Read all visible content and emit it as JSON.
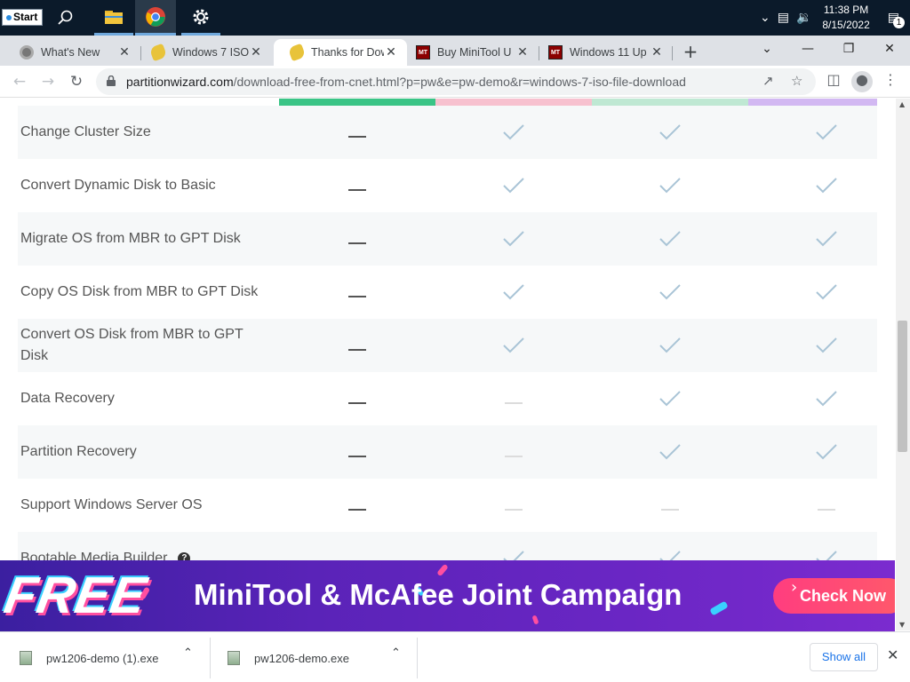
{
  "taskbar": {
    "start_label": "Start",
    "time": "11:38 PM",
    "date": "8/15/2022",
    "notification_count": "1"
  },
  "tabs": [
    {
      "title": "What's New",
      "favicon": "gear-favicon"
    },
    {
      "title": "Windows 7 ISO",
      "favicon": "windows-favicon"
    },
    {
      "title": "Thanks for Dow",
      "favicon": "windows-favicon",
      "active": true
    },
    {
      "title": "Buy MiniTool U",
      "favicon": "minitool-favicon"
    },
    {
      "title": "Windows 11 Up",
      "favicon": "minitool-favicon"
    }
  ],
  "favicon_text": "MT",
  "address": {
    "host": "partitionwizard.com",
    "path": "/download-free-from-cnet.html?p=pw&e=pw-demo&r=windows-7-iso-file-download"
  },
  "plan_colors": [
    "#3ac486",
    "#f7c1cf",
    "#bfe8d3",
    "#d2b8f2"
  ],
  "features": [
    {
      "name": "Change Cluster Size",
      "cells": [
        "dash",
        "check",
        "check",
        "check"
      ]
    },
    {
      "name": "Convert Dynamic Disk to Basic",
      "cells": [
        "dash",
        "check",
        "check",
        "check"
      ]
    },
    {
      "name": "Migrate OS from MBR to GPT Disk",
      "cells": [
        "dash",
        "check",
        "check",
        "check"
      ]
    },
    {
      "name": "Copy OS Disk from MBR to GPT Disk",
      "cells": [
        "dash",
        "check",
        "check",
        "check"
      ]
    },
    {
      "name": "Convert OS Disk from MBR to GPT Disk",
      "cells": [
        "dash",
        "check",
        "check",
        "check"
      ]
    },
    {
      "name": "Data Recovery",
      "cells": [
        "dash",
        "light-dash",
        "check",
        "check"
      ]
    },
    {
      "name": "Partition Recovery",
      "cells": [
        "dash",
        "light-dash",
        "check",
        "check"
      ]
    },
    {
      "name": "Support Windows Server OS",
      "cells": [
        "dash",
        "light-dash",
        "light-dash",
        "light-dash"
      ]
    },
    {
      "name": "Bootable Media Builder",
      "cells": [
        "dash",
        "check",
        "check",
        "check"
      ],
      "help": "?"
    }
  ],
  "banner": {
    "free_text": "FREE",
    "title": "MiniTool & McAfee Joint Campaign",
    "cta": "Check Now"
  },
  "downloads": {
    "items": [
      "pw1206-demo (1).exe",
      "pw1206-demo.exe"
    ],
    "show_all": "Show all"
  },
  "colors": {
    "check": "#a9c4d6",
    "accent_link": "#1a73e8"
  }
}
